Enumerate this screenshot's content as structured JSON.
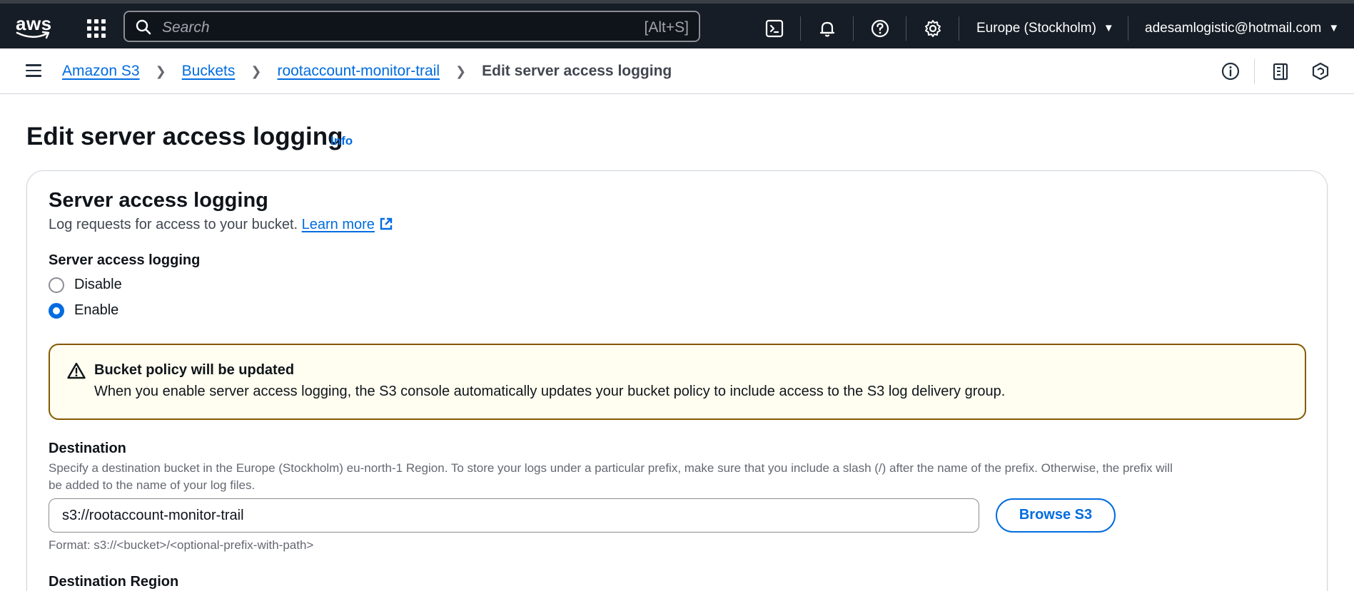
{
  "topbar": {
    "logo_text": "aws",
    "search_placeholder": "Search",
    "search_shortcut": "[Alt+S]",
    "icons": [
      "cloudshell-icon",
      "bell-icon",
      "help-icon",
      "settings-icon"
    ],
    "region": "Europe (Stockholm)",
    "account": "adesamlogistic@hotmail.com"
  },
  "breadcrumb": {
    "items": [
      "Amazon S3",
      "Buckets",
      "rootaccount-monitor-trail"
    ],
    "current": "Edit server access logging"
  },
  "page": {
    "title": "Edit server access logging",
    "info_link": "Info"
  },
  "section": {
    "title": "Server access logging",
    "description": "Log requests for access to your bucket.",
    "learn_more": "Learn more",
    "logging_label": "Server access logging",
    "options": [
      {
        "label": "Disable",
        "selected": false
      },
      {
        "label": "Enable",
        "selected": true
      }
    ]
  },
  "alert": {
    "title": "Bucket policy will be updated",
    "body": "When you enable server access logging, the S3 console automatically updates your bucket policy to include access to the S3 log delivery group."
  },
  "destination": {
    "label": "Destination",
    "help_line1": "Specify a destination bucket in the Europe (Stockholm) eu-north-1 Region. To store your logs under a particular prefix, make sure that you include a slash (/) after the name of the prefix. Otherwise, the prefix will",
    "help_line2": "be added to the name of your log files.",
    "value": "s3://rootaccount-monitor-trail",
    "browse_label": "Browse S3",
    "format_hint": "Format: s3://<bucket>/<optional-prefix-with-path>"
  },
  "destination_region": {
    "label": "Destination Region"
  },
  "colors": {
    "topbar_bg": "#161d26",
    "link": "#006ce0",
    "warning_border": "#855900",
    "warning_bg": "#fffef0"
  }
}
